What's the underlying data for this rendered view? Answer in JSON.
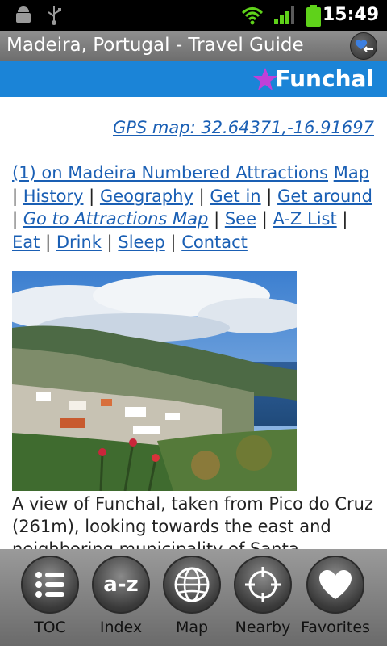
{
  "statusbar": {
    "time": "15:49"
  },
  "titlebar": {
    "title": "Madeira, Portugal - Travel Guide"
  },
  "heading": {
    "title": "Funchal"
  },
  "gps": "GPS map: 32.64371,-16.91697",
  "links": {
    "numbered": "(1) on Madeira Numbered Attractions",
    "map": "Map",
    "history": "History",
    "geography": "Geography",
    "get_in": "Get in",
    "get_around": "Get around",
    "attractions_map": "Go to Attractions Map",
    "see": "See",
    "az_list": "A-Z List",
    "eat": "Eat",
    "drink": "Drink",
    "sleep": "Sleep",
    "contact": "Contact",
    "sep": "|"
  },
  "caption": "A view of Funchal, taken from Pico do Cruz (261m), looking towards the east and neighboring municipality of Santa",
  "toolbar": {
    "toc": "TOC",
    "index": "Index",
    "map": "Map",
    "nearby": "Nearby",
    "favorites": "Favorites",
    "index_icon_text": "a-z"
  },
  "colors": {
    "accent": "#1b84d7",
    "link": "#1a5fb4",
    "star": "#c040d8"
  }
}
